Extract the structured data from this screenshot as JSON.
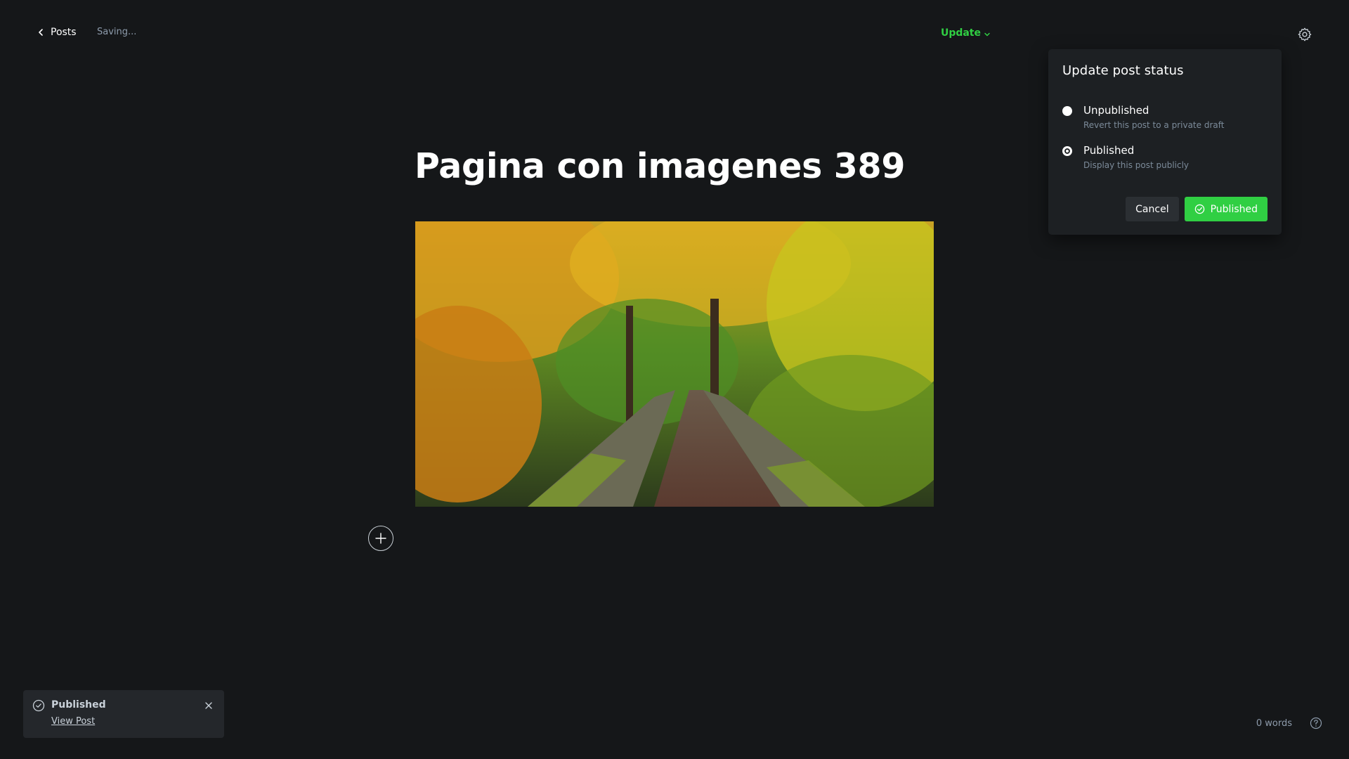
{
  "header": {
    "back_label": "Posts",
    "status_text": "Saving...",
    "update_label": "Update"
  },
  "popover": {
    "title": "Update post status",
    "options": [
      {
        "label": "Unpublished",
        "description": "Revert this post to a private draft",
        "selected": false
      },
      {
        "label": "Published",
        "description": "Display this post publicly",
        "selected": true
      }
    ],
    "cancel_label": "Cancel",
    "confirm_label": "Published"
  },
  "editor": {
    "title": "Pagina con imagenes 389"
  },
  "toast": {
    "title": "Published",
    "link": "View Post"
  },
  "footer": {
    "word_count": "0 words"
  },
  "colors": {
    "accent": "#30cf43",
    "background": "#151719",
    "panel": "#1d2023"
  },
  "icons": {
    "back": "chevron-left-icon",
    "dropdown": "chevron-down-icon",
    "settings": "gear-icon",
    "check": "check-circle-icon",
    "add": "plus-icon",
    "close": "close-icon",
    "help": "question-circle-icon"
  }
}
